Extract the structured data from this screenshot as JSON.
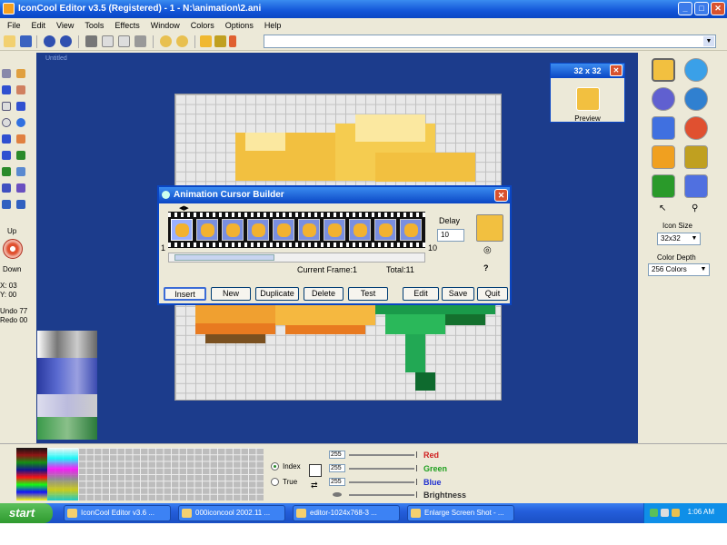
{
  "window": {
    "title": "IconCool Editor v3.5 (Registered) - 1 - N:\\animation\\2.ani"
  },
  "menu": [
    "File",
    "Edit",
    "View",
    "Tools",
    "Effects",
    "Window",
    "Colors",
    "Options",
    "Help"
  ],
  "canvas": {
    "label": "Untitled"
  },
  "preview": {
    "title": "32 x 32",
    "label": "Preview"
  },
  "left_panel": {
    "top_label": "Up",
    "bottom_label": "Down",
    "x_readout": "X: 03",
    "y_readout": "Y: 00",
    "undo_readout": "Undo 77",
    "redo_readout": "Redo 00"
  },
  "right_panel": {
    "icon_size_label": "Icon Size",
    "icon_size_value": "32x32",
    "color_depth_label": "Color Depth",
    "color_depth_value": "256 Colors"
  },
  "dialog": {
    "title": "Animation Cursor Builder",
    "delay_label": "Delay",
    "delay_value": "10",
    "frame_start": "1",
    "frame_end": "10",
    "current_frame": "Current Frame:1",
    "total": "Total:11",
    "buttons": {
      "insert": "Insert",
      "new": "New",
      "duplicate": "Duplicate",
      "delete": "Delete",
      "test": "Test",
      "edit": "Edit",
      "save": "Save",
      "quit": "Quit"
    }
  },
  "color_panel": {
    "index_label": "Index",
    "true_label": "True",
    "red_label": "Red",
    "green_label": "Green",
    "blue_label": "Blue",
    "brightness_label": "Brightness",
    "red_value": "255",
    "green_value": "255",
    "blue_value": "255"
  },
  "taskbar": {
    "start": "start",
    "tasks": [
      "IconCool Editor v3.6 ...",
      "000iconcool 2002.11 ...",
      "editor-1024x768-3 ...",
      "Enlarge Screen Shot - ..."
    ],
    "clock": "1:06 AM"
  },
  "colors": {
    "workarea": "#1c3c8c",
    "titlebar": "#0a46c4",
    "flower_yellow": "#f2c040",
    "leaf_green": "#1a9a4a"
  }
}
